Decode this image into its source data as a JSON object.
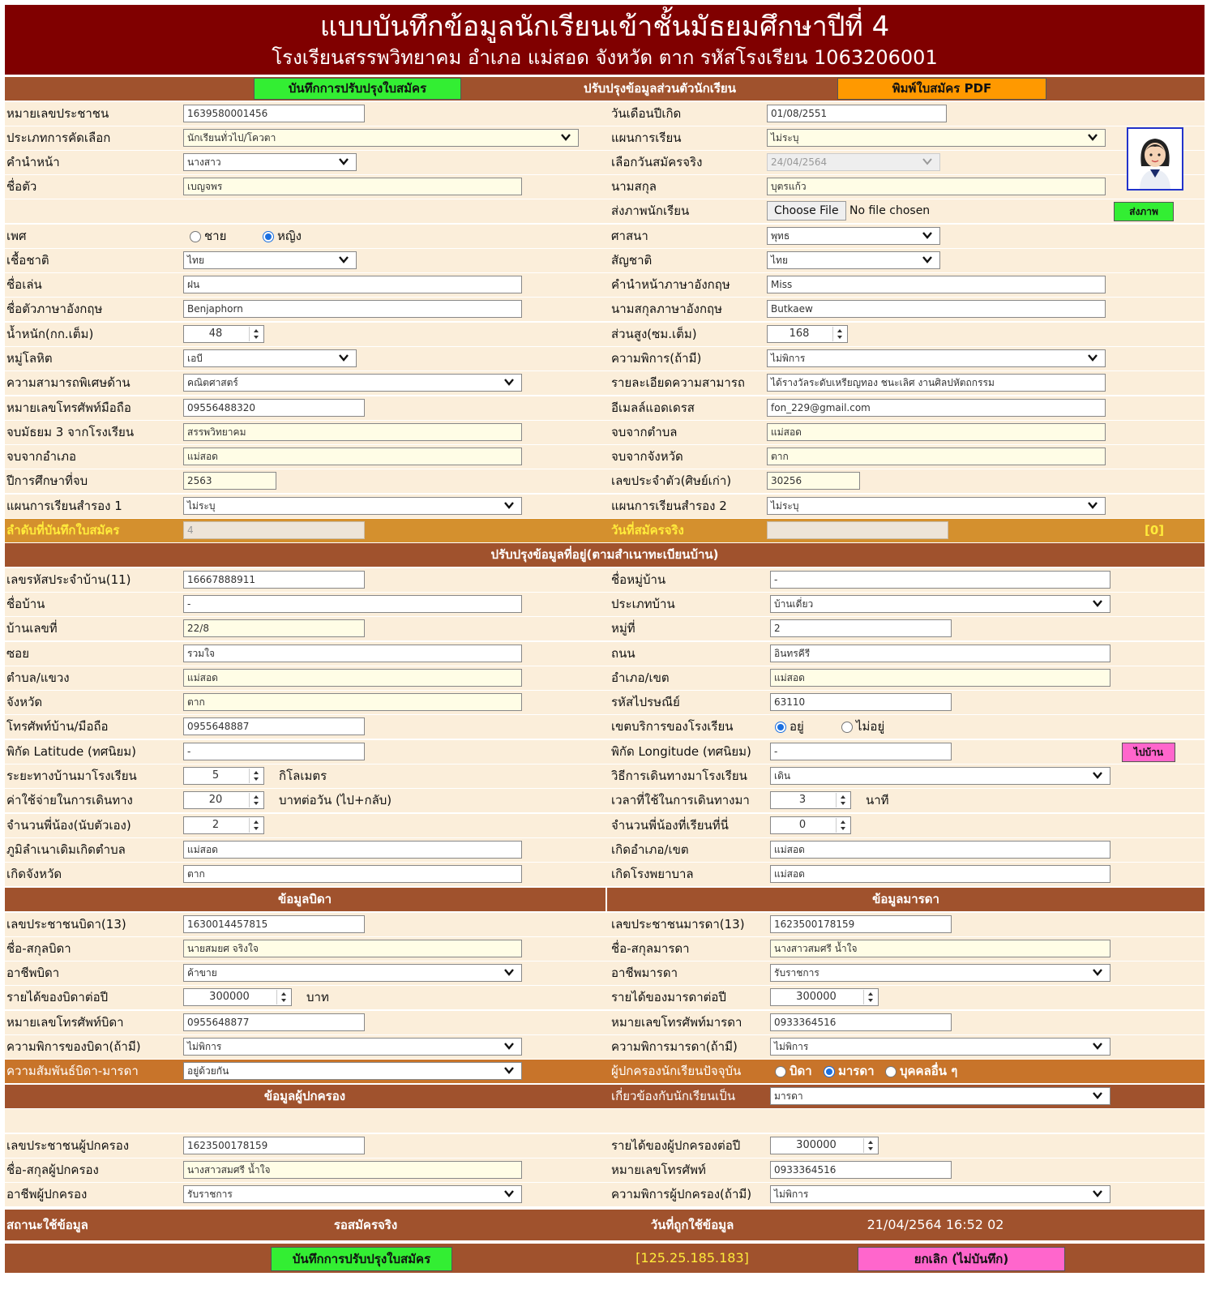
{
  "header": {
    "title": "แบบบันทึกข้อมูลนักเรียนเข้าชั้นมัธยมศึกษาปีที่ 4",
    "subtitle": "โรงเรียนสรรพวิทยาคม อำเภอ แม่สอด จังหวัด ตาก รหัสโรงเรียน 1063206001"
  },
  "top_bar": {
    "save_label": "บันทึกการปรับปรุงใบสมัคร",
    "section_title": "ปรับปรุงข้อมูลส่วนตัวนักเรียน",
    "print_label": "พิมพ์ใบสมัคร PDF"
  },
  "personal": {
    "id_label": "หมายเลขประชาชน",
    "id_value": "1639580001456",
    "dob_label": "วันเดือนปีเกิด",
    "dob_value": "01/08/2551",
    "selection_type_label": "ประเภทการคัดเลือก",
    "selection_type_value": "นักเรียนทั่วไป/โควตา",
    "study_plan_label": "แผนการเรียน",
    "study_plan_value": "ไม่ระบุ",
    "prefix_label": "คำนำหน้า",
    "prefix_value": "นางสาว",
    "apply_date_label": "เลือกวันสมัครจริง",
    "apply_date_value": "24/04/2564",
    "firstname_label": "ชื่อตัว",
    "firstname_value": "เบญจพร",
    "lastname_label": "นามสกุล",
    "lastname_value": "บุตรแก้ว",
    "photo_label": "ส่งภาพนักเรียน",
    "choose_file": "Choose File",
    "no_file": "No file chosen",
    "send_photo": "ส่งภาพ",
    "gender_label": "เพศ",
    "gender_male": "ชาย",
    "gender_female": "หญิง",
    "religion_label": "ศาสนา",
    "religion_value": "พุทธ",
    "ethnicity_label": "เชื้อชาติ",
    "ethnicity_value": "ไทย",
    "nationality_label": "สัญชาติ",
    "nationality_value": "ไทย",
    "nickname_label": "ชื่อเล่น",
    "nickname_value": "ฝน",
    "eng_prefix_label": "คำนำหน้าภาษาอังกฤษ",
    "eng_prefix_value": "Miss",
    "eng_firstname_label": "ชื่อตัวภาษาอังกฤษ",
    "eng_firstname_value": "Benjaphorn",
    "eng_lastname_label": "นามสกุลภาษาอังกฤษ",
    "eng_lastname_value": "Butkaew",
    "weight_label": "น้ำหนัก(กก.เต็ม)",
    "weight_value": "48",
    "height_label": "ส่วนสูง(ซม.เต็ม)",
    "height_value": "168",
    "blood_label": "หมู่โลหิต",
    "blood_value": "เอบี",
    "disability_label": "ความพิการ(ถ้ามี)",
    "disability_value": "ไม่พิการ",
    "talent_label": "ความสามารถพิเศษด้าน",
    "talent_value": "คณิตศาสตร์",
    "talent_detail_label": "รายละเอียดความสามารถ",
    "talent_detail_value": "ได้รางวัลระดับเหรียญทอง ชนะเลิศ งานศิลปหัตถกรรม",
    "mobile_label": "หมายเลขโทรศัพท์มือถือ",
    "mobile_value": "09556488320",
    "email_label": "อีเมลล์แอดเดรส",
    "email_value": "fon_229@gmail.com",
    "m3_school_label": "จบมัธยม 3 จากโรงเรียน",
    "m3_school_value": "สรรพวิทยาคม",
    "grad_subdistrict_label": "จบจากตำบล",
    "grad_subdistrict_value": "แม่สอด",
    "grad_district_label": "จบจากอำเภอ",
    "grad_district_value": "แม่สอด",
    "grad_province_label": "จบจากจังหวัด",
    "grad_province_value": "ตาก",
    "grad_year_label": "ปีการศึกษาที่จบ",
    "grad_year_value": "2563",
    "student_no_label": "เลขประจำตัว(ศิษย์เก่า)",
    "student_no_value": "30256",
    "alt_plan1_label": "แผนการเรียนสำรอง 1",
    "alt_plan1_value": "ไม่ระบุ",
    "alt_plan2_label": "แผนการเรียนสำรอง 2",
    "alt_plan2_value": "ไม่ระบุ",
    "order_label": "ลำดับที่บันทึกใบสมัคร",
    "order_value": "4",
    "apply_real_label": "วันที่สมัครจริง",
    "apply_real_value": "",
    "counter": "[0]"
  },
  "address": {
    "section_title": "ปรับปรุงข้อมูลที่อยู่(ตามสำเนาทะเบียนบ้าน)",
    "house_code_label": "เลขรหัสประจำบ้าน(11)",
    "house_code_value": "16667888911",
    "village_name_label": "ชื่อหมู่บ้าน",
    "village_name_value": "-",
    "house_name_label": "ชื่อบ้าน",
    "house_name_value": "-",
    "house_type_label": "ประเภทบ้าน",
    "house_type_value": "บ้านเดี่ยว",
    "house_no_label": "บ้านเลขที่",
    "house_no_value": "22/8",
    "moo_label": "หมู่ที่",
    "moo_value": "2",
    "soi_label": "ซอย",
    "soi_value": "รวมใจ",
    "road_label": "ถนน",
    "road_value": "อินทรคีรี",
    "subdistrict_label": "ตำบล/แขวง",
    "subdistrict_value": "แม่สอด",
    "district_label": "อำเภอ/เขต",
    "district_value": "แม่สอด",
    "province_label": "จังหวัด",
    "province_value": "ตาก",
    "postcode_label": "รหัสไปรษณีย์",
    "postcode_value": "63110",
    "phone_label": "โทรศัพท์บ้าน/มือถือ",
    "phone_value": "0955648887",
    "service_area_label": "เขตบริการของโรงเรียน",
    "service_in": "อยู่",
    "service_out": "ไม่อยู่",
    "lat_label": "พิกัด Latitude (ทศนิยม)",
    "lat_value": "-",
    "lng_label": "พิกัด Longitude (ทศนิยม)",
    "lng_value": "-",
    "go_home": "ไปบ้าน",
    "distance_label": "ระยะทางบ้านมาโรงเรียน",
    "distance_value": "5",
    "distance_unit": "กิโลเมตร",
    "travel_method_label": "วิธีการเดินทางมาโรงเรียน",
    "travel_method_value": "เดิน",
    "travel_cost_label": "ค่าใช้จ่ายในการเดินทาง",
    "travel_cost_value": "20",
    "travel_cost_unit": "บาทต่อวัน (ไป+กลับ)",
    "travel_time_label": "เวลาที่ใช้ในการเดินทางมา",
    "travel_time_value": "3",
    "travel_time_unit": "นาที",
    "siblings_label": "จำนวนพี่น้อง(นับตัวเอง)",
    "siblings_value": "2",
    "siblings_school_label": "จำนวนพี่น้องที่เรียนที่นี่",
    "siblings_school_value": "0",
    "birth_subdistrict_label": "ภูมิลำเนาเดิมเกิดตำบล",
    "birth_subdistrict_value": "แม่สอด",
    "birth_district_label": "เกิดอำเภอ/เขต",
    "birth_district_value": "แม่สอด",
    "birth_province_label": "เกิดจังหวัด",
    "birth_province_value": "ตาก",
    "birth_hospital_label": "เกิดโรงพยาบาล",
    "birth_hospital_value": "แม่สอด"
  },
  "parents": {
    "father_title": "ข้อมูลบิดา",
    "mother_title": "ข้อมูลมารดา",
    "father_id_label": "เลขประชาชนบิดา(13)",
    "father_id_value": "1630014457815",
    "mother_id_label": "เลขประชาชนมารดา(13)",
    "mother_id_value": "1623500178159",
    "father_name_label": "ชื่อ-สกุลบิดา",
    "father_name_value": "นายสมยศ จริงใจ",
    "mother_name_label": "ชื่อ-สกุลมารดา",
    "mother_name_value": "นางสาวสมศรี น้ำใจ",
    "father_job_label": "อาชีพบิดา",
    "father_job_value": "ค้าขาย",
    "mother_job_label": "อาชีพมารดา",
    "mother_job_value": "รับราชการ",
    "father_income_label": "รายได้ของบิดาต่อปี",
    "father_income_value": "300000",
    "baht": "บาท",
    "mother_income_label": "รายได้ของมารดาต่อปี",
    "mother_income_value": "300000",
    "father_phone_label": "หมายเลขโทรศัพท์บิดา",
    "father_phone_value": "0955648877",
    "mother_phone_label": "หมายเลขโทรศัพท์มารดา",
    "mother_phone_value": "0933364516",
    "father_disability_label": "ความพิการของบิดา(ถ้ามี)",
    "father_disability_value": "ไม่พิการ",
    "mother_disability_label": "ความพิการมารดา(ถ้ามี)",
    "mother_disability_value": "ไม่พิการ",
    "relation_label": "ความสัมพันธ์บิดา-มารดา",
    "relation_value": "อยู่ด้วยกัน",
    "current_guardian_label": "ผู้ปกครองนักเรียนปัจจุบัน",
    "g_father": "บิดา",
    "g_mother": "มารดา",
    "g_other": "บุคคลอื่น ๆ"
  },
  "guardian": {
    "section_title": "ข้อมูลผู้ปกครอง",
    "related_label": "เกี่ยวข้องกับนักเรียนเป็น",
    "related_value": "มารดา",
    "id_label": "เลขประชาชนผู้ปกครอง",
    "id_value": "1623500178159",
    "income_label": "รายได้ของผู้ปกครองต่อปี",
    "income_value": "300000",
    "name_label": "ชื่อ-สกุลผู้ปกครอง",
    "name_value": "นางสาวสมศรี น้ำใจ",
    "phone_label": "หมายเลขโทรศัพท์",
    "phone_value": "0933364516",
    "job_label": "อาชีพผู้ปกครอง",
    "job_value": "รับราชการ",
    "disability_label": "ความพิการผู้ปกครอง(ถ้ามี)",
    "disability_value": "ไม่พิการ"
  },
  "footer": {
    "status_label": "สถานะใช้ข้อมูล",
    "status_value": "รอสมัครจริง",
    "used_date_label": "วันที่ถูกใช้ข้อมูล",
    "used_date_value": "21/04/2564 16:52 02",
    "save_label": "บันทึกการปรับปรุงใบสมัคร",
    "ip": "[125.25.185.183]",
    "cancel_label": "ยกเลิก (ไม่บันทึก)"
  },
  "colors": {
    "banner": "#800000",
    "header_row": "#a0522d",
    "row": "#fbeeda",
    "save": "#33ee33",
    "print": "#ff9900",
    "cancel": "#ff66cc"
  }
}
